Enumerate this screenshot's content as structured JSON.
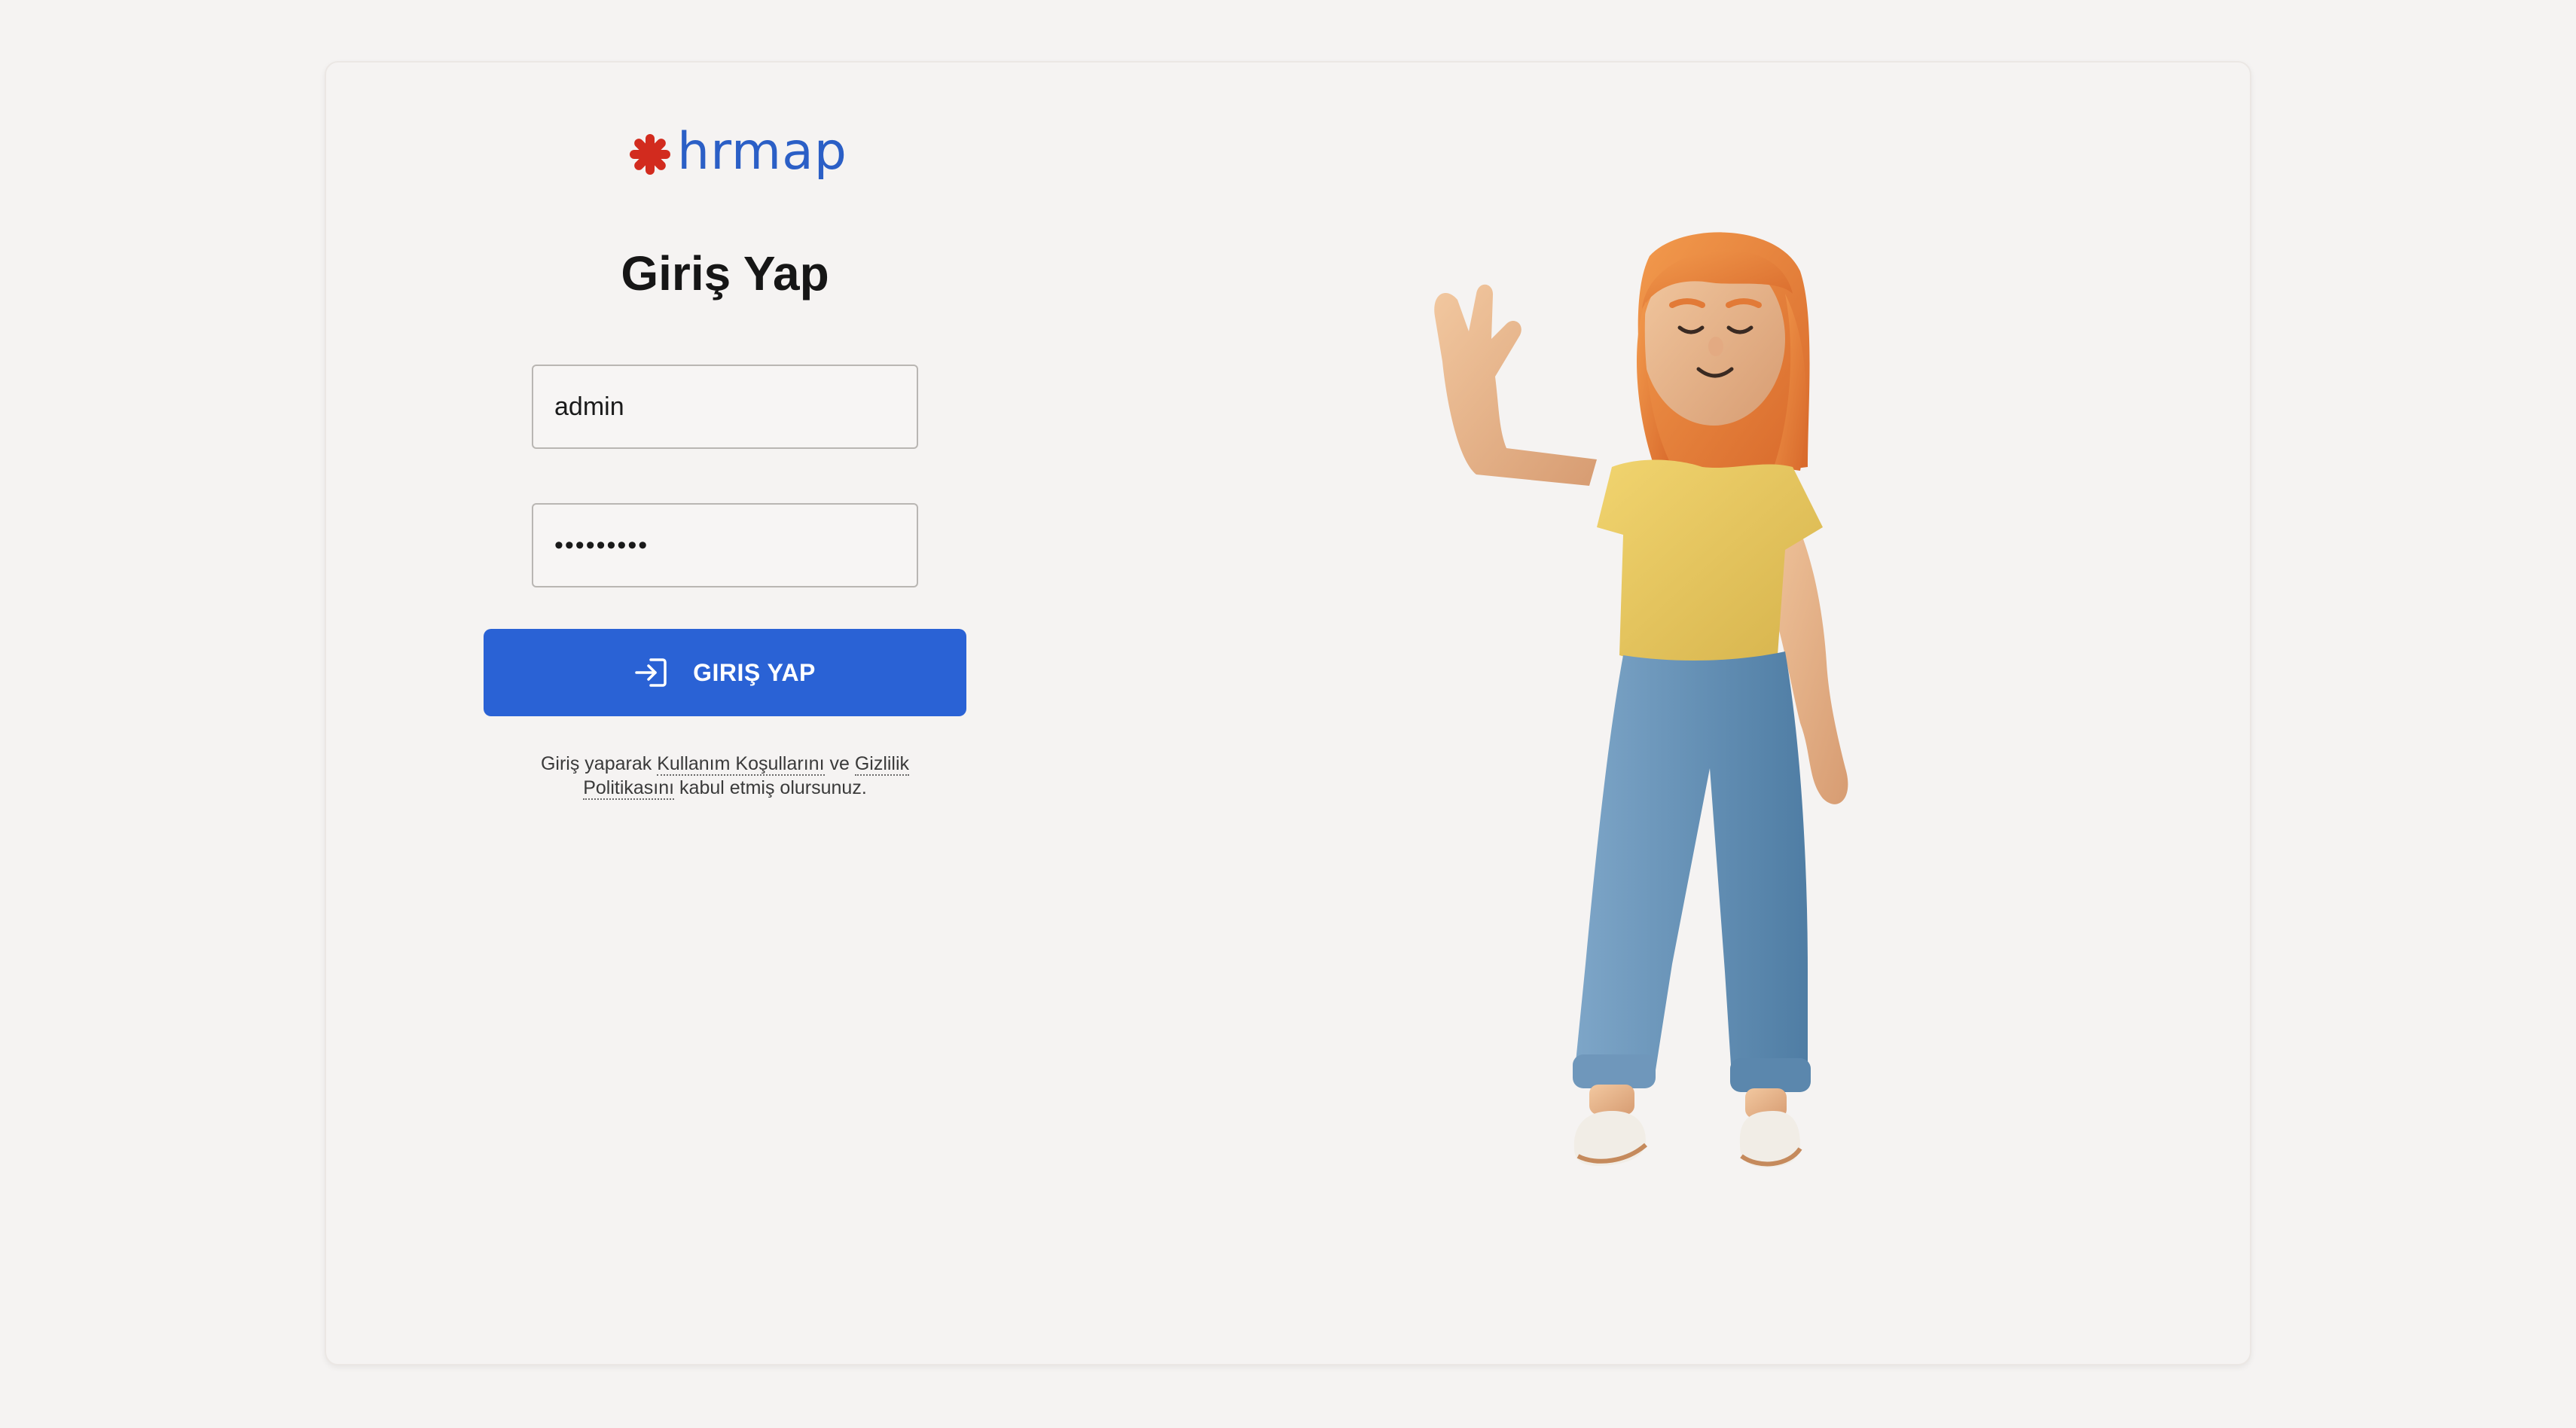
{
  "brand": {
    "name": "hrmap",
    "logo_mark_color": "#d22b1e",
    "text_color": "#2b5fc6"
  },
  "login": {
    "title": "Giriş Yap",
    "username_value": "admin",
    "password_value": "•••••••••",
    "button_label": "GIRIŞ YAP",
    "button_color": "#2a62d5"
  },
  "terms": {
    "prefix": "Giriş yaparak ",
    "terms_link": "Kullanım Koşullarını",
    "middle": " ve ",
    "privacy_link": "Gizlilik Politikasını",
    "suffix": " kabul etmiş olursunuz."
  },
  "illustration": {
    "icon": "waving-woman-illustration"
  }
}
